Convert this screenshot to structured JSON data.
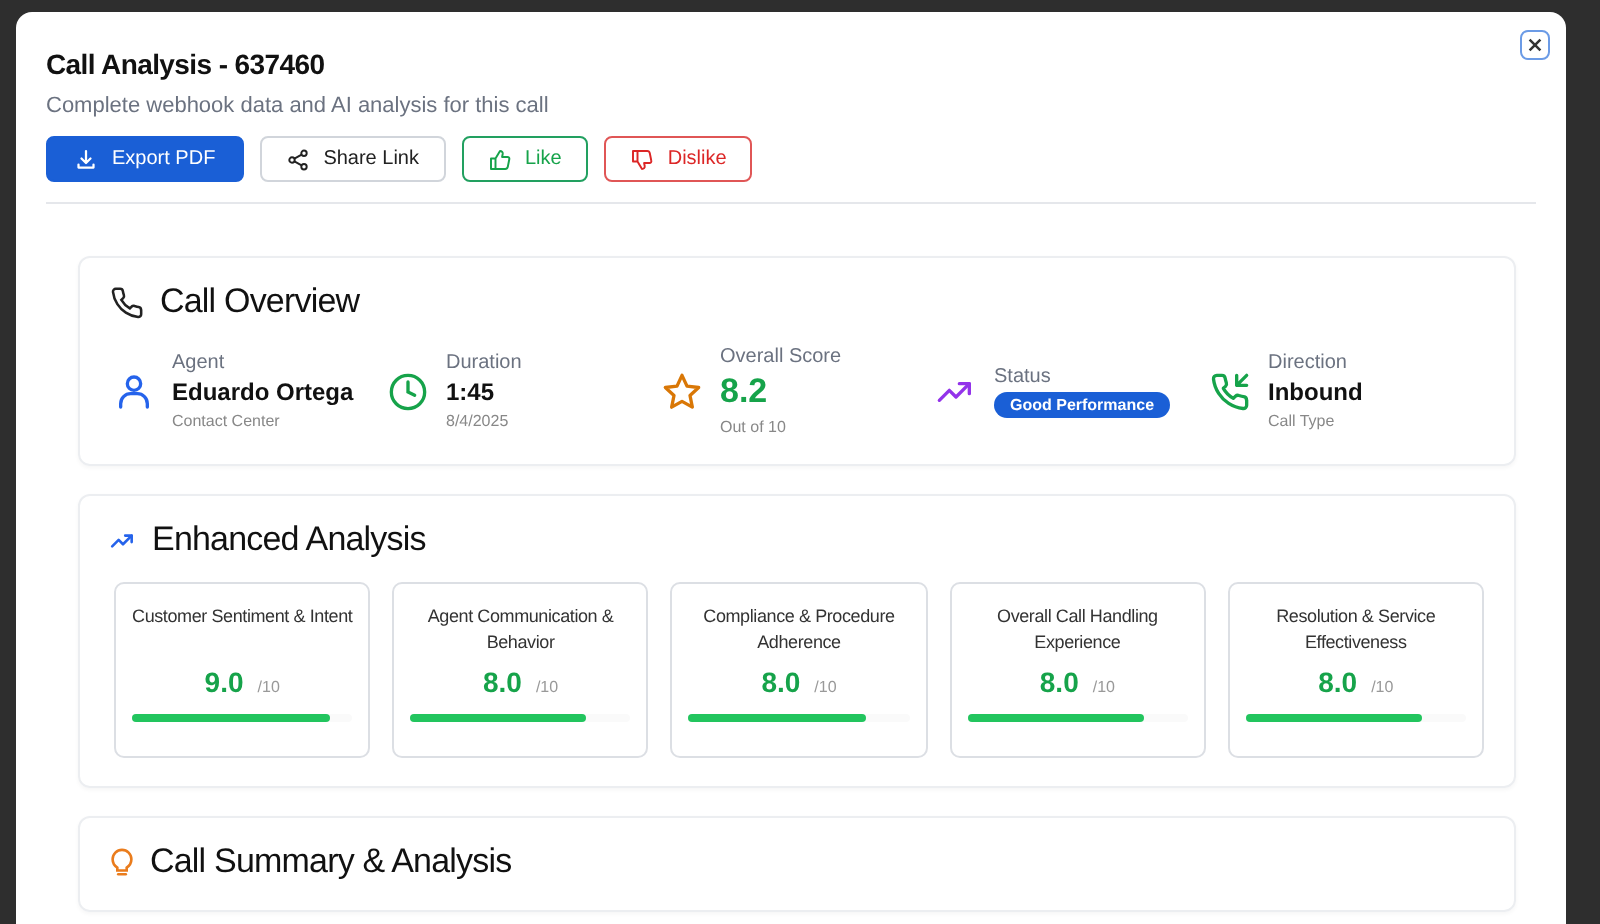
{
  "dialog": {
    "title": "Call Analysis - 637460",
    "subtitle": "Complete webhook data and AI analysis for this call"
  },
  "actions": [
    {
      "kind": "export",
      "label": "Export PDF"
    },
    {
      "kind": "share",
      "label": "Share Link"
    },
    {
      "kind": "like",
      "label": "Like"
    },
    {
      "kind": "dislike",
      "label": "Dislike"
    }
  ],
  "overview": {
    "title": "Call Overview",
    "items": [
      {
        "kind": "agent",
        "label": "Agent",
        "value": "Eduardo Ortega",
        "note": "Contact Center"
      },
      {
        "kind": "duration",
        "label": "Duration",
        "value": "1:45",
        "note": "8/4/2025"
      },
      {
        "kind": "score",
        "label": "Overall Score",
        "value": "8.2",
        "note": "Out of 10"
      },
      {
        "kind": "status",
        "label": "Status",
        "badge": "Good Performance"
      },
      {
        "kind": "direction",
        "label": "Direction",
        "value": "Inbound",
        "note": "Call Type"
      }
    ]
  },
  "enhanced": {
    "title": "Enhanced Analysis",
    "metrics": [
      {
        "name": "Customer Sentiment & Intent",
        "score": "9.0",
        "scale": "/10",
        "level": 0.9
      },
      {
        "name": "Agent Communication & Behavior",
        "score": "8.0",
        "scale": "/10",
        "level": 0.8
      },
      {
        "name": "Compliance & Procedure Adherence",
        "score": "8.0",
        "scale": "/10",
        "level": 0.8
      },
      {
        "name": "Overall Call Handling Experience",
        "score": "8.0",
        "scale": "/10",
        "level": 0.8
      },
      {
        "name": "Resolution & Service Effectiveness",
        "score": "8.0",
        "scale": "/10",
        "level": 0.8
      }
    ]
  },
  "summary": {
    "title": "Call Summary & Analysis"
  }
}
